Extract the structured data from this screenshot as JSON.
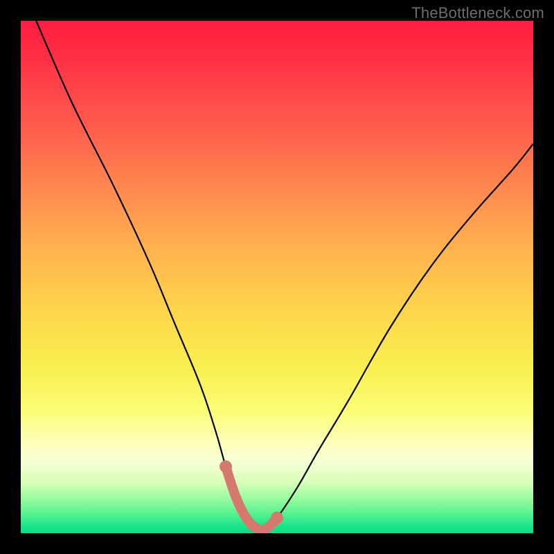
{
  "watermark": "TheBottleneck.com",
  "chart_data": {
    "type": "line",
    "title": "",
    "xlabel": "",
    "ylabel": "",
    "xlim": [
      0,
      100
    ],
    "ylim": [
      0,
      100
    ],
    "grid": false,
    "legend": false,
    "series": [
      {
        "name": "bottleneck-curve",
        "color": "#000000",
        "x": [
          3,
          10,
          18,
          25,
          30,
          35,
          38,
          40,
          42,
          44,
          46,
          48,
          50,
          54,
          58,
          64,
          72,
          80,
          88,
          96,
          100
        ],
        "y": [
          100,
          84,
          68,
          53,
          41,
          29,
          20,
          13,
          7,
          3,
          1,
          1,
          3,
          9,
          16,
          26,
          40,
          52,
          62,
          71,
          76
        ]
      }
    ],
    "trough_band": {
      "name": "optimal-range-highlight",
      "color": "#d5786e",
      "x_start": 40,
      "x_end": 50,
      "y_level": 4
    },
    "background_gradient": {
      "stops": [
        {
          "pos": 0.0,
          "color": "#ff1d3f"
        },
        {
          "pos": 0.33,
          "color": "#ff8a4f"
        },
        {
          "pos": 0.68,
          "color": "#faf050"
        },
        {
          "pos": 0.86,
          "color": "#f7ffd6"
        },
        {
          "pos": 1.0,
          "color": "#07dd87"
        }
      ]
    }
  }
}
